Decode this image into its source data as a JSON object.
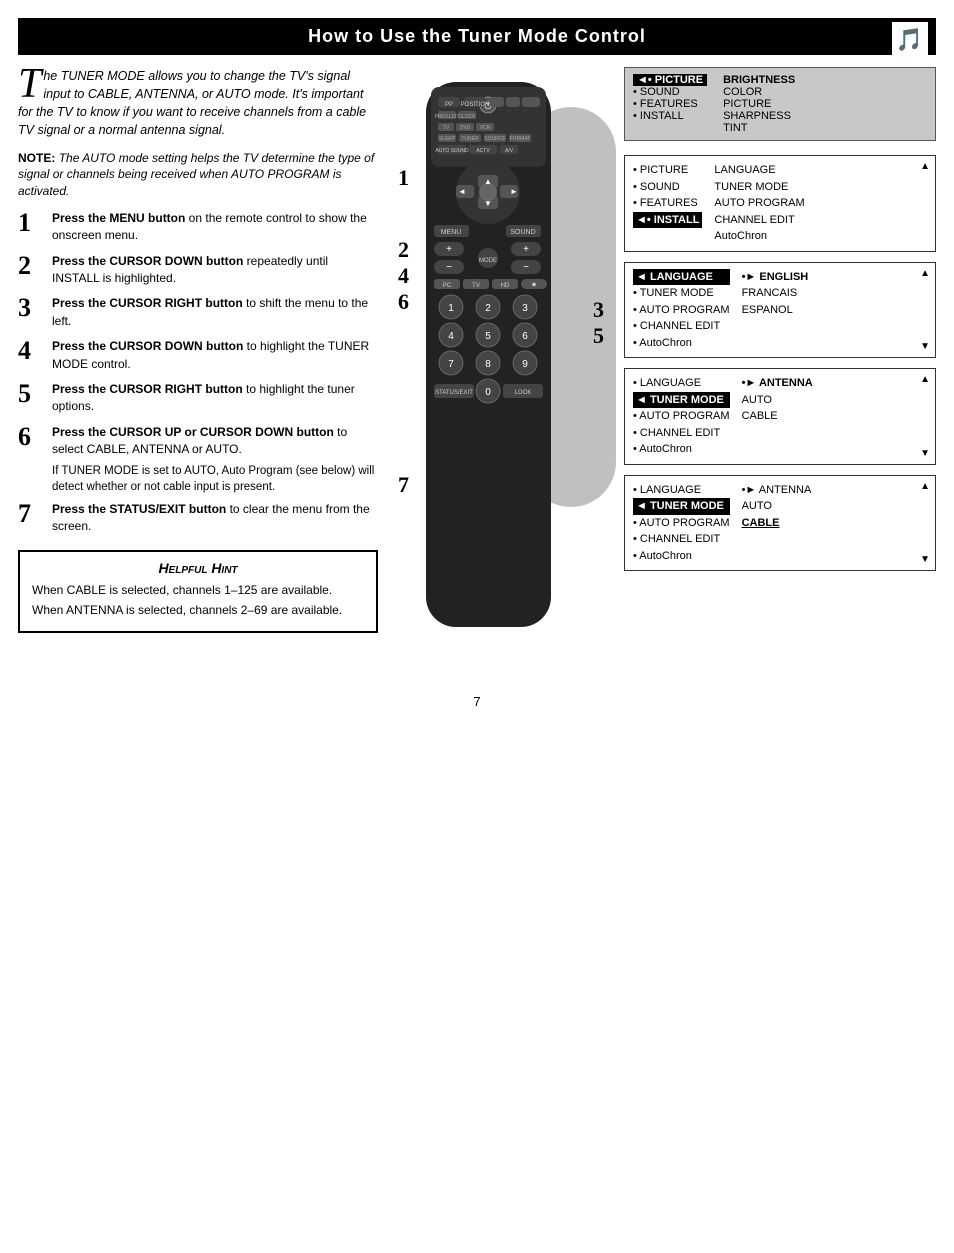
{
  "header": {
    "title": "How to Use the Tuner Mode Control",
    "icon": "🎵"
  },
  "intro": {
    "drop_cap": "T",
    "text": "he TUNER MODE allows you to change the TV's signal input to CABLE, ANTENNA, or AUTO mode. It's important for the TV to know if you want to receive channels from a cable TV signal or a normal antenna signal."
  },
  "note": {
    "label": "NOTE:",
    "text": " The AUTO mode setting helps the TV determine the type of signal or channels being received when AUTO PROGRAM is activated."
  },
  "steps": [
    {
      "number": "1",
      "text_bold": "Press the MENU button",
      "text": " on the remote control to show the onscreen menu."
    },
    {
      "number": "2",
      "text_bold": "Press the CURSOR DOWN button",
      "text": " repeatedly until INSTALL is highlighted."
    },
    {
      "number": "3",
      "text_bold": "Press the CURSOR RIGHT button",
      "text": " to shift the menu to the left."
    },
    {
      "number": "4",
      "text_bold": "Press the CURSOR DOWN button",
      "text": " to highlight the TUNER MODE control."
    },
    {
      "number": "5",
      "text_bold": "Press the CURSOR RIGHT button",
      "text": " to highlight the tuner options."
    },
    {
      "number": "6",
      "text_bold": "Press the CURSOR UP or CURSOR DOWN button",
      "text": " to select CABLE, ANTENNA or AUTO."
    },
    {
      "number": "7",
      "text_bold": "Press the STATUS/EXIT button",
      "text": " to clear the menu from the screen."
    }
  ],
  "step6_subnote": "If TUNER MODE is set to AUTO, Auto Program (see below) will detect whether or not cable input is present.",
  "helpful_hint": {
    "title": "Helpful Hint",
    "hints": [
      "When CABLE is selected, channels 1–125 are available.",
      "When ANTENNA is selected, channels 2–69 are available."
    ]
  },
  "menu_top_left": {
    "items": [
      {
        "label": "• PICTURE",
        "selected": true
      },
      {
        "label": "• SOUND",
        "selected": false
      },
      {
        "label": "• FEATURES",
        "selected": false
      },
      {
        "label": "• INSTALL",
        "selected": false
      }
    ]
  },
  "menu_top_right": {
    "items": [
      "BRIGHTNESS",
      "COLOR",
      "PICTURE",
      "SHARPNESS",
      "TINT"
    ]
  },
  "menu_panels": [
    {
      "id": "panel1",
      "left_items": [
        {
          "label": "• PICTURE",
          "selected": false
        },
        {
          "label": "• SOUND",
          "selected": false
        },
        {
          "label": "• FEATURES",
          "selected": false
        },
        {
          "label": "◄• INSTALL",
          "selected": true
        }
      ],
      "right_items": [
        "LANGUAGE",
        "TUNER MODE",
        "AUTO PROGRAM",
        "CHANNEL EDIT",
        "AutoChron"
      ],
      "arrow_up": true,
      "arrow_down": false
    },
    {
      "id": "panel2",
      "left_items": [
        {
          "label": "◄ LANGUAGE",
          "selected": true
        },
        {
          "label": "• TUNER MODE",
          "selected": false
        },
        {
          "label": "• AUTO PROGRAM",
          "selected": false
        },
        {
          "label": "• CHANNEL EDIT",
          "selected": false
        },
        {
          "label": "• AutoChron",
          "selected": false
        }
      ],
      "right_items": [
        "•► ENGLISH",
        "FRANCAIS",
        "ESPANOL"
      ],
      "arrow_up": true,
      "arrow_down": true
    },
    {
      "id": "panel3",
      "left_items": [
        {
          "label": "• LANGUAGE",
          "selected": false
        },
        {
          "label": "◄ TUNER MODE",
          "selected": true
        },
        {
          "label": "• AUTO PROGRAM",
          "selected": false
        },
        {
          "label": "• CHANNEL EDIT",
          "selected": false
        },
        {
          "label": "• AutoChron",
          "selected": false
        }
      ],
      "right_items": [
        "•► ANTENNA",
        "AUTO",
        "CABLE"
      ],
      "arrow_up": true,
      "arrow_down": true
    },
    {
      "id": "panel4",
      "left_items": [
        {
          "label": "• LANGUAGE",
          "selected": false
        },
        {
          "label": "◄ TUNER MODE",
          "selected": true
        },
        {
          "label": "• AUTO PROGRAM",
          "selected": false
        },
        {
          "label": "• CHANNEL EDIT",
          "selected": false
        },
        {
          "label": "• AutoChron",
          "selected": false
        }
      ],
      "right_items_bold": [
        "•► ANTENNA",
        "AUTO",
        "CABLE"
      ],
      "right_selected": 2,
      "arrow_up": true,
      "arrow_down": true
    }
  ],
  "page_number": "7"
}
